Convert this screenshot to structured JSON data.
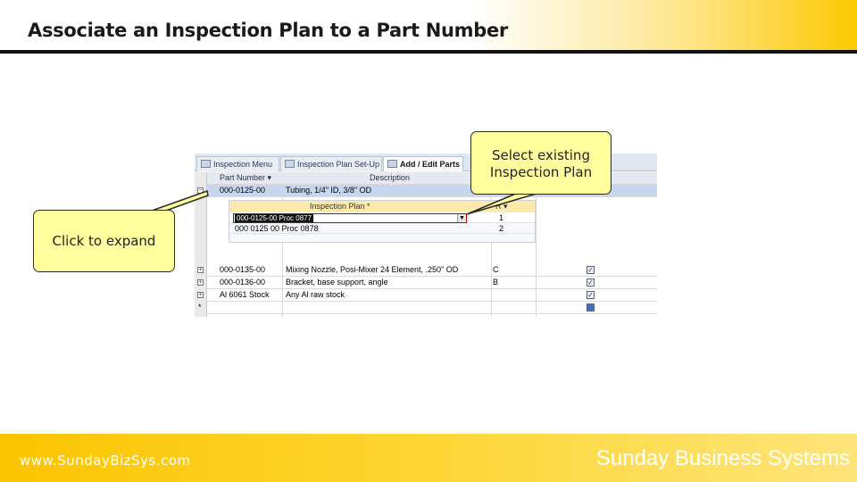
{
  "slide": {
    "title": "Associate an Inspection Plan to a Part Number",
    "footer_url": "www.SundayBizSys.com",
    "footer_brand": "Sunday Business Systems"
  },
  "callouts": {
    "expand": "Click to expand",
    "select_line1": "Select existing",
    "select_line2": "Inspection Plan"
  },
  "access": {
    "tabs": [
      {
        "label": "Inspection Menu"
      },
      {
        "label": "Inspection Plan Set-Up"
      },
      {
        "label": "Add / Edit Parts"
      }
    ],
    "columns": {
      "part_number": "Part Number ▾",
      "description": "Description"
    },
    "rows": [
      {
        "part": "000-0125-00",
        "description": "Tubing, 1/4\" ID, 3/8\" OD"
      },
      {
        "part": "000-0135-00",
        "description": "Mixing Nozzle, Posi-Mixer 24 Element, .250\" OD",
        "rev": "C"
      },
      {
        "part": "000-0136-00",
        "description": "Bracket, base support, angle",
        "rev": "B"
      },
      {
        "part": "Al 6061 Stock",
        "description": "Any Al raw stock",
        "rev": ""
      }
    ],
    "subform": {
      "header": "Inspection Plan *",
      "seq_header": "R ▾",
      "rows": [
        {
          "plan": "000-0125-00 Proc 0877",
          "seq": "1"
        },
        {
          "plan": "000 0125 00 Proc 0878",
          "seq": "2"
        }
      ]
    },
    "new_row_marker": "*"
  },
  "colors": {
    "header_accent": "#fcc900",
    "footer_bg": "#fcc400",
    "callout_fill": "#ffff9e"
  }
}
